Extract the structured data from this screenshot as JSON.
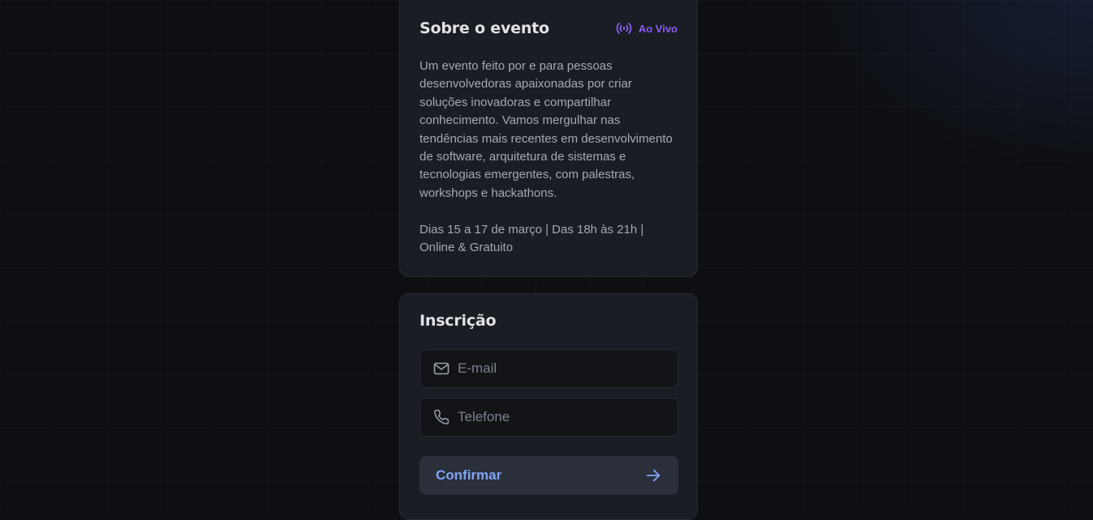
{
  "about": {
    "title": "Sobre o evento",
    "live_badge": "Ao Vivo",
    "description": "Um evento feito por e para pessoas desenvolvedoras apaixonadas por criar soluções inovadoras e compartilhar conhecimento. Vamos mergulhar nas tendências mais recentes em desenvolvimento de software, arquitetura de sistemas e tecnologias emergentes, com palestras, workshops e hackathons.",
    "info": "Dias 15 a 17 de março | Das 18h às 21h | Online & Gratuito"
  },
  "signup": {
    "title": "Inscrição",
    "email": {
      "placeholder": "E-mail",
      "value": "",
      "icon": "mail-icon"
    },
    "phone": {
      "placeholder": "Telefone",
      "value": "",
      "icon": "phone-icon"
    },
    "confirm_label": "Confirmar",
    "confirm_icon": "arrow-right-icon"
  },
  "colors": {
    "accent_purple": "#8b5cf6",
    "accent_blue": "#81a4f7",
    "card_bg": "#1a1d23",
    "page_bg": "#0d0f12"
  }
}
